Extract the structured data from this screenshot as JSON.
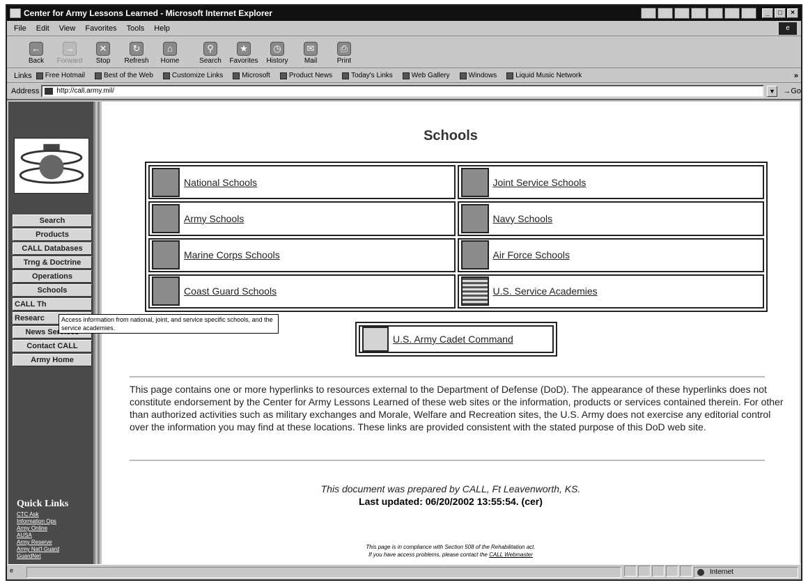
{
  "window": {
    "title": "Center for Army Lessons Learned - Microsoft Internet Explorer"
  },
  "menu": [
    "File",
    "Edit",
    "View",
    "Favorites",
    "Tools",
    "Help"
  ],
  "toolbar": [
    {
      "label": "Back",
      "icon": "back-arrow-icon",
      "disabled": false
    },
    {
      "label": "Forward",
      "icon": "forward-arrow-icon",
      "disabled": true
    },
    {
      "label": "Stop",
      "icon": "stop-icon",
      "disabled": false
    },
    {
      "label": "Refresh",
      "icon": "refresh-icon",
      "disabled": false
    },
    {
      "label": "Home",
      "icon": "home-icon",
      "disabled": false
    },
    {
      "label": "Search",
      "icon": "search-icon",
      "disabled": false
    },
    {
      "label": "Favorites",
      "icon": "favorites-icon",
      "disabled": false
    },
    {
      "label": "History",
      "icon": "history-icon",
      "disabled": false
    },
    {
      "label": "Mail",
      "icon": "mail-icon",
      "disabled": false
    },
    {
      "label": "Print",
      "icon": "print-icon",
      "disabled": false
    }
  ],
  "links": {
    "label": "Links",
    "items": [
      "Free Hotmail",
      "Best of the Web",
      "Customize Links",
      "Microsoft",
      "Product News",
      "Today's Links",
      "Web Gallery",
      "Windows",
      "Liquid Music Network"
    ],
    "more": "»"
  },
  "address": {
    "label": "Address",
    "value": "http://call.army.mil/",
    "go": "Go"
  },
  "sidebar": {
    "nav": [
      "Search",
      "Products",
      "CALL Databases",
      "Trng & Doctrine",
      "Operations",
      "Schools",
      "CALL Th",
      "Researc",
      "News Services",
      "Contact CALL",
      "Army Home"
    ],
    "quick_links_title": "Quick Links",
    "quick_links": [
      "CTC Ask",
      "Information Ops",
      "Army Online",
      "AUSA",
      "Army Reserve",
      "Army Nat'l Guard",
      "GuardNet"
    ]
  },
  "tooltip": "Access information from national, joint, and service specific schools, and the service academies.",
  "page": {
    "title": "Schools",
    "schools": [
      {
        "label": "National Schools",
        "icon": "national-schools-icon"
      },
      {
        "label": "Joint Service Schools",
        "icon": "joint-service-seal-icon"
      },
      {
        "label": "Army Schools",
        "icon": "army-seal-icon"
      },
      {
        "label": "Navy Schools",
        "icon": "navy-anchor-icon"
      },
      {
        "label": "Marine Corps Schools",
        "icon": "marine-corps-emblem-icon"
      },
      {
        "label": "Air Force Schools",
        "icon": "air-force-emblem-icon"
      },
      {
        "label": "Coast Guard Schools",
        "icon": "coast-guard-stripe-icon"
      },
      {
        "label": "U.S. Service Academies",
        "icon": "us-flag-icon"
      }
    ],
    "cadet_command": {
      "label": "U.S. Army Cadet Command",
      "icon": "cadet-command-map-icon"
    },
    "disclaimer": "This page contains one or more hyperlinks to resources external to the Department of Defense (DoD). The appearance of these hyperlinks does not constitute endorsement by the Center for Army Lessons Learned of these web sites or the information, products or services contained therein. For other than authorized activities such as military exchanges and Morale, Welfare and Recreation sites, the U.S. Army does not exercise any editorial control over the information you may find at these locations. These links are provided consistent with the stated purpose of this DoD web site.",
    "prepared": "This document was prepared by CALL, Ft Leavenworth, KS.",
    "updated": "Last updated: 06/20/2002 13:55:54. (cer)",
    "compliance_1": "This page is in compliance with Section 508 of the Rehabilitation act.",
    "compliance_2": "If you have access problems, please contact the",
    "webmaster": "CALL Webmaster"
  },
  "status": {
    "zone": "Internet"
  }
}
